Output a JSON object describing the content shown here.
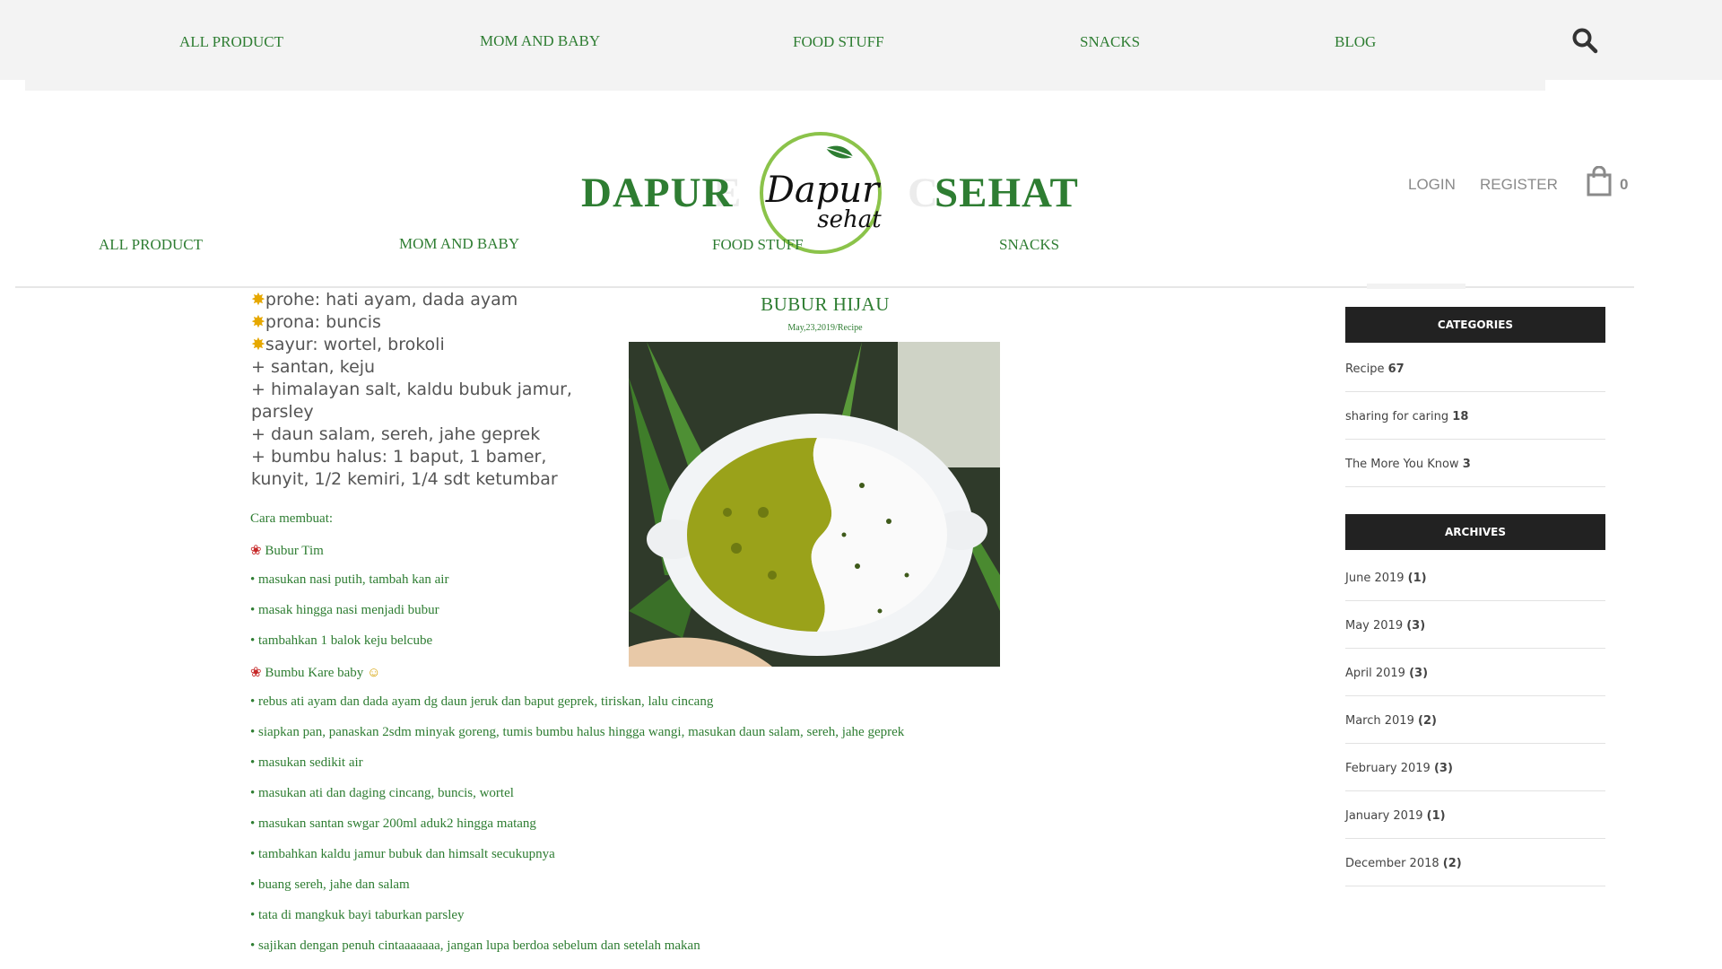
{
  "top_nav": {
    "items": [
      "ALL PRODUCT",
      "MOM AND BABY",
      "FOOD STUFF",
      "SNACKS",
      "BLOG"
    ],
    "search_icon": "search-icon"
  },
  "brand": {
    "left": "DAPUR",
    "right": "SEHAT",
    "logo_line1": "Dapur",
    "logo_line2": "sehat"
  },
  "account": {
    "login": "LOGIN",
    "register": "REGISTER",
    "cart_count": "0"
  },
  "sub_nav": {
    "items": [
      "ALL PRODUCT",
      "MOM AND BABY",
      "FOOD STUFF",
      "SNACKS"
    ]
  },
  "ingredients": [
    "prohe: hati ayam, dada ayam",
    "prona: buncis",
    "sayur: wortel, brokoli",
    "+ santan, keju",
    "+ himalayan salt, kaldu bubuk jamur,",
    "parsley",
    "+ daun salam, sereh, jahe geprek",
    "+ bumbu halus: 1 baput, 1 bamer,",
    "kunyit, 1/2 kemiri, 1/4 sdt ketumbar"
  ],
  "post": {
    "title": "BUBUR HIJAU",
    "meta": "May,23,2019/Recipe"
  },
  "steps": {
    "heading": "Cara membuat:",
    "section1": "Bubur Tim",
    "lines1": [
      "• masukan nasi putih, tambah kan air",
      "• masak hingga nasi menjadi bubur",
      "• tambahkan 1 balok keju belcube"
    ],
    "section2": "Bumbu Kare baby",
    "lines2": [
      "• rebus ati ayam dan dada ayam dg daun jeruk dan baput geprek, tiriskan, lalu cincang",
      "• siapkan pan, panaskan 2sdm minyak goreng, tumis bumbu halus hingga wangi, masukan daun salam, sereh, jahe geprek",
      "• masukan sedikit air",
      "• masukan ati dan daging cincang, buncis, wortel",
      "• masukan santan swgar 200ml aduk2 hingga matang",
      "• tambahkan kaldu jamur bubuk dan himsalt secukupnya",
      "• buang sereh, jahe dan salam",
      "• tata di mangkuk bayi taburkan parsley",
      "• sajikan dengan penuh cintaaaaaaa, jangan lupa berdoa sebelum dan setelah makan"
    ]
  },
  "sidebar": {
    "categories_title": "CATEGORIES",
    "categories": [
      {
        "name": "Recipe",
        "count": "67"
      },
      {
        "name": "sharing for caring",
        "count": "18"
      },
      {
        "name": "The More You Know",
        "count": "3"
      }
    ],
    "archives_title": "ARCHIVES",
    "archives": [
      {
        "name": "June 2019",
        "count": "(1)"
      },
      {
        "name": "May 2019",
        "count": "(3)"
      },
      {
        "name": "April 2019",
        "count": "(3)"
      },
      {
        "name": "March 2019",
        "count": "(2)"
      },
      {
        "name": "February 2019",
        "count": "(3)"
      },
      {
        "name": "January 2019",
        "count": "(1)"
      },
      {
        "name": "December 2018",
        "count": "(2)"
      }
    ]
  }
}
